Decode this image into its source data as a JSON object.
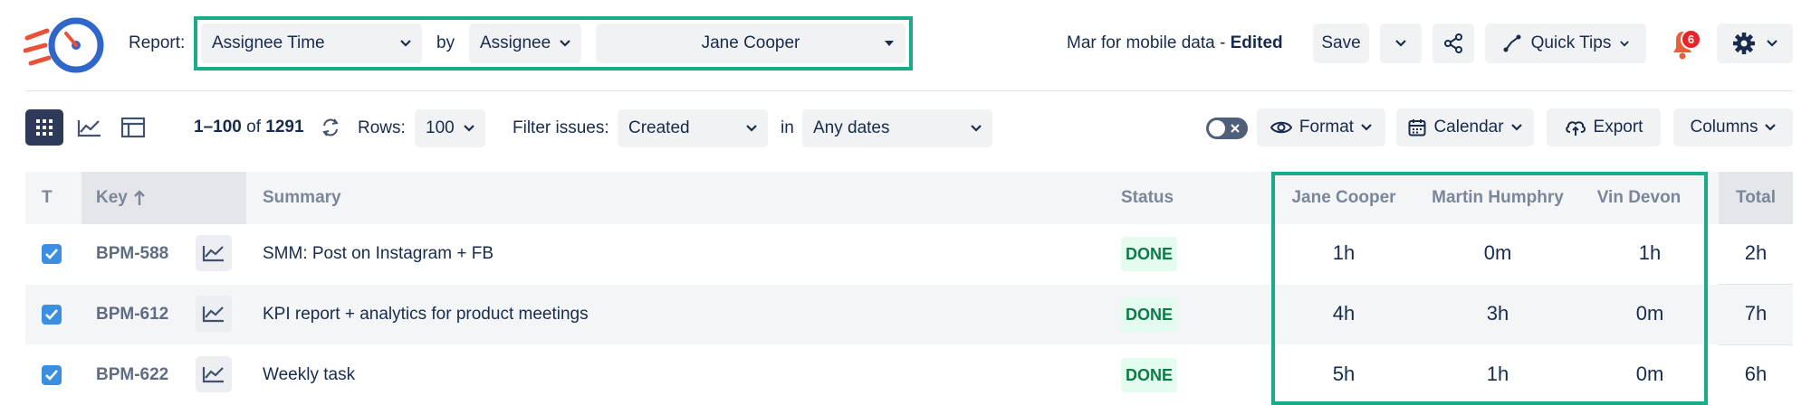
{
  "header": {
    "report_label": "Report:",
    "report_value": "Assignee Time",
    "by_label": "by",
    "by_value": "Assignee",
    "user_value": "Jane Cooper",
    "report_name": "Mar for mobile data - ",
    "edited": "Edited",
    "save": "Save",
    "quick_tips": "Quick Tips",
    "notif_count": "6"
  },
  "toolbar": {
    "range": "1–100",
    "of": "of",
    "total": "1291",
    "rows_label": "Rows:",
    "rows_value": "100",
    "filter_label": "Filter issues:",
    "filter_value": "Created",
    "in_label": "in",
    "dates_value": "Any dates",
    "format": "Format",
    "calendar": "Calendar",
    "export": "Export",
    "columns": "Columns"
  },
  "table": {
    "headers": {
      "t": "T",
      "key": "Key",
      "summary": "Summary",
      "status": "Status",
      "u1": "Jane Cooper",
      "u2": "Martin Humphry",
      "u3": "Vin Devon",
      "total": "Total"
    },
    "rows": [
      {
        "key": "BPM-588",
        "summary": "SMM: Post on Instagram + FB",
        "status": "DONE",
        "u1": "1h",
        "u2": "0m",
        "u3": "1h",
        "total": "2h"
      },
      {
        "key": "BPM-612",
        "summary": "KPI report + analytics for product meetings",
        "status": "DONE",
        "u1": "4h",
        "u2": "3h",
        "u3": "0m",
        "total": "7h"
      },
      {
        "key": "BPM-622",
        "summary": "Weekly task",
        "status": "DONE",
        "u1": "5h",
        "u2": "1h",
        "u3": "0m",
        "total": "6h"
      }
    ]
  },
  "colors": {
    "highlight": "#1bab8b",
    "accent": "#3b8fe0",
    "done_bg": "#e3fcef",
    "done_text": "#0e7a48",
    "badge": "#e5252a"
  }
}
